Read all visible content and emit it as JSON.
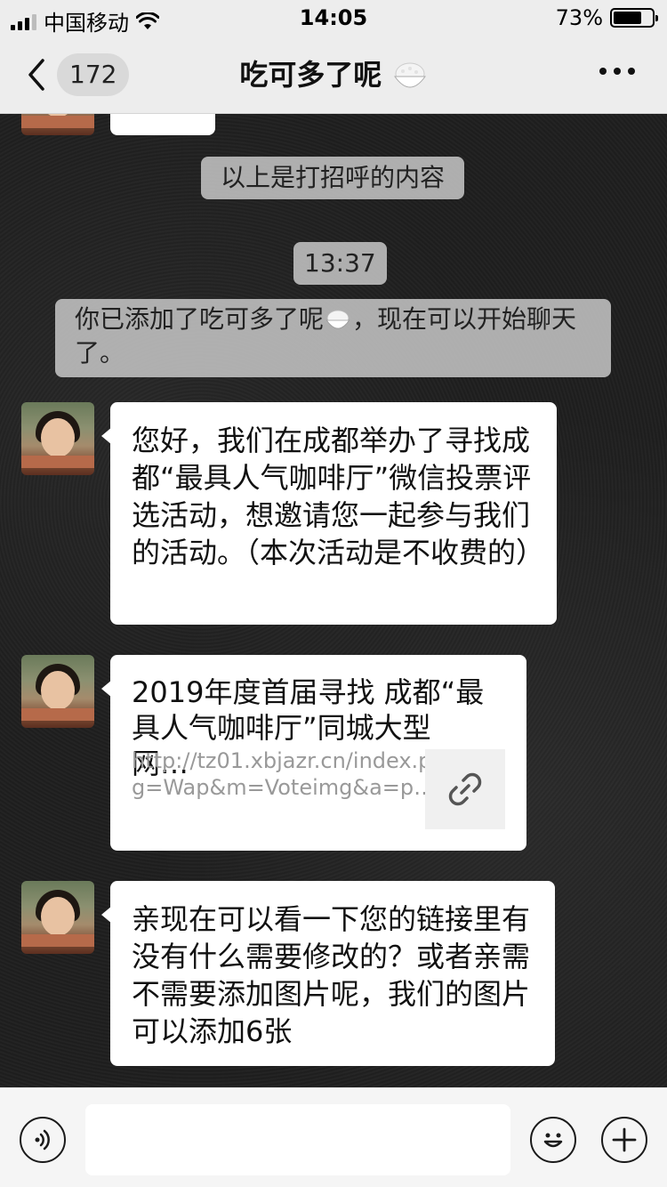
{
  "status_bar": {
    "carrier": "中国移动",
    "time": "14:05",
    "battery_percent_text": "73%",
    "battery_level": 0.73
  },
  "nav": {
    "unread_count": "172",
    "title": "吃可多了呢",
    "title_emoji_icon": "rice-bowl-icon"
  },
  "chat": {
    "system_greeting": "以上是打招呼的内容",
    "timestamp": "13:37",
    "system_added_prefix": "你已添加了吃可多了呢",
    "system_added_suffix": "，现在可以开始聊天了。",
    "messages": [
      {
        "type": "text",
        "text": "您好，我们在成都举办了寻找成都“最具人气咖啡厅”微信投票评选活动，想邀请您一起参与我们的活动。（本次活动是不收费的）"
      },
      {
        "type": "link",
        "title": "2019年度首届寻找 成都“最具人气咖啡厅”同城大型网…",
        "url": "http://tz01.xbjazr.cn/index.php?g=Wap&m=Voteimg&a=p…",
        "thumb_icon": "link-icon"
      },
      {
        "type": "text",
        "text": "亲现在可以看一下您的链接里有没有什么需要修改的？或者亲需不需要添加图片呢，我们的图片可以添加6张"
      }
    ]
  },
  "input_bar": {
    "voice_icon": "voice-icon",
    "emoji_icon": "emoji-icon",
    "plus_icon": "plus-icon",
    "input_value": ""
  }
}
